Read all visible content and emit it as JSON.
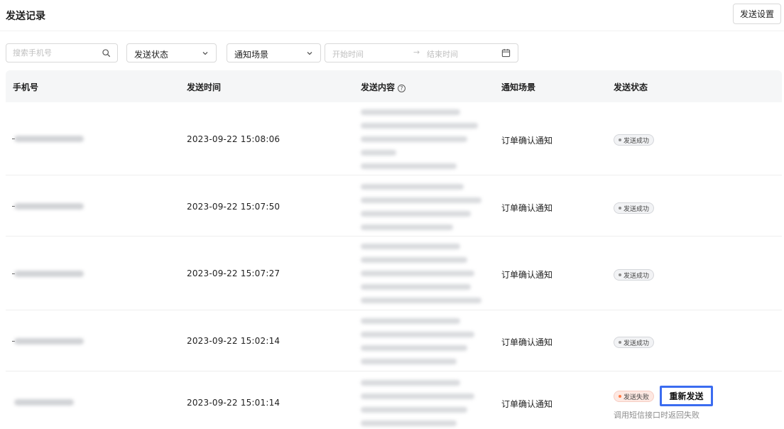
{
  "header": {
    "title": "发送记录",
    "settings_label": "发送设置"
  },
  "filters": {
    "search_placeholder": "搜索手机号",
    "status_select": "发送状态",
    "scene_select": "通知场景",
    "date_start_placeholder": "开始时间",
    "date_arrow": "→",
    "date_end_placeholder": "结束时间"
  },
  "table": {
    "columns": {
      "phone": "手机号",
      "time": "发送时间",
      "content": "发送内容",
      "content_help": "?",
      "scene": "通知场景",
      "status": "发送状态"
    },
    "rows": [
      {
        "time": "2023-09-22 15:08:06",
        "scene": "订单确认通知",
        "status": "发送成功"
      },
      {
        "time": "2023-09-22 15:07:50",
        "scene": "订单确认通知",
        "status": "发送成功"
      },
      {
        "time": "2023-09-22 15:07:27",
        "scene": "订单确认通知",
        "status": "发送成功"
      },
      {
        "time": "2023-09-22 15:02:14",
        "scene": "订单确认通知",
        "status": "发送成功"
      },
      {
        "time": "2023-09-22 15:01:14",
        "scene": "订单确认通知",
        "status": "发送失败",
        "action": "重新发送",
        "reason": "调用短信接口时返回失败"
      }
    ]
  },
  "colors": {
    "header_bg": "#f5f6f7",
    "success_badge_bg": "#f2f3f5",
    "fail_badge_bg": "#fde8e2",
    "fail_dot": "#ff7a45",
    "highlight_border": "#3b6cf0"
  },
  "icons": {
    "search": "search-icon",
    "dropdown": "chevron-down-icon",
    "calendar": "calendar-icon",
    "help": "question-circle-icon"
  }
}
